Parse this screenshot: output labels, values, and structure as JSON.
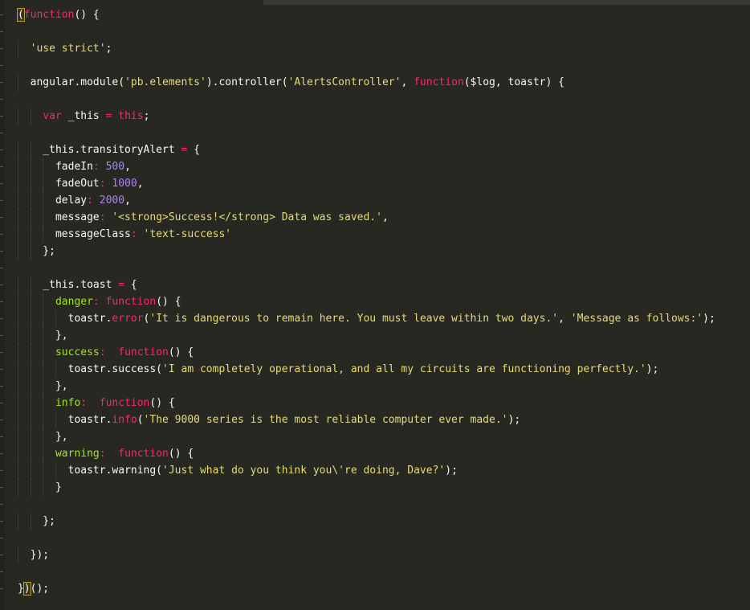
{
  "lines": [
    [
      {
        "t": "(",
        "c": "plain bracket-hl"
      },
      {
        "t": "function",
        "c": "kw"
      },
      {
        "t": "() {",
        "c": "plain"
      }
    ],
    [],
    [
      {
        "t": "  ",
        "c": "plain"
      },
      {
        "t": "'use strict'",
        "c": "str"
      },
      {
        "t": ";",
        "c": "plain"
      }
    ],
    [],
    [
      {
        "t": "  angular.module(",
        "c": "plain"
      },
      {
        "t": "'pb.elements'",
        "c": "str"
      },
      {
        "t": ").controller(",
        "c": "plain"
      },
      {
        "t": "'AlertsController'",
        "c": "str"
      },
      {
        "t": ", ",
        "c": "plain"
      },
      {
        "t": "function",
        "c": "kw"
      },
      {
        "t": "($log, toastr) {",
        "c": "plain"
      }
    ],
    [],
    [
      {
        "t": "    ",
        "c": "plain"
      },
      {
        "t": "var",
        "c": "kw"
      },
      {
        "t": " _this ",
        "c": "plain"
      },
      {
        "t": "=",
        "c": "kw"
      },
      {
        "t": " ",
        "c": "plain"
      },
      {
        "t": "this",
        "c": "kw"
      },
      {
        "t": ";",
        "c": "plain"
      }
    ],
    [],
    [
      {
        "t": "    _this.transitoryAlert ",
        "c": "plain"
      },
      {
        "t": "=",
        "c": "kw"
      },
      {
        "t": " {",
        "c": "plain"
      }
    ],
    [
      {
        "t": "      fadeIn",
        "c": "plain"
      },
      {
        "t": ":",
        "c": "kw"
      },
      {
        "t": " ",
        "c": "plain"
      },
      {
        "t": "500",
        "c": "num"
      },
      {
        "t": ",",
        "c": "plain"
      }
    ],
    [
      {
        "t": "      fadeOut",
        "c": "plain"
      },
      {
        "t": ":",
        "c": "kw"
      },
      {
        "t": " ",
        "c": "plain"
      },
      {
        "t": "1000",
        "c": "num"
      },
      {
        "t": ",",
        "c": "plain"
      }
    ],
    [
      {
        "t": "      delay",
        "c": "plain"
      },
      {
        "t": ":",
        "c": "kw"
      },
      {
        "t": " ",
        "c": "plain"
      },
      {
        "t": "2000",
        "c": "num"
      },
      {
        "t": ",",
        "c": "plain"
      }
    ],
    [
      {
        "t": "      message",
        "c": "plain"
      },
      {
        "t": ":",
        "c": "kw"
      },
      {
        "t": " ",
        "c": "plain"
      },
      {
        "t": "'<strong>Success!</strong> Data was saved.'",
        "c": "str"
      },
      {
        "t": ",",
        "c": "plain"
      }
    ],
    [
      {
        "t": "      messageClass",
        "c": "plain"
      },
      {
        "t": ":",
        "c": "kw"
      },
      {
        "t": " ",
        "c": "plain"
      },
      {
        "t": "'text-success'",
        "c": "str"
      }
    ],
    [
      {
        "t": "    };",
        "c": "plain"
      }
    ],
    [],
    [
      {
        "t": "    _this.toast ",
        "c": "plain"
      },
      {
        "t": "=",
        "c": "kw"
      },
      {
        "t": " {",
        "c": "plain"
      }
    ],
    [
      {
        "t": "      ",
        "c": "plain"
      },
      {
        "t": "danger",
        "c": "prop"
      },
      {
        "t": ":",
        "c": "kw"
      },
      {
        "t": " ",
        "c": "plain"
      },
      {
        "t": "function",
        "c": "kw"
      },
      {
        "t": "() {",
        "c": "plain"
      }
    ],
    [
      {
        "t": "        toastr.",
        "c": "plain"
      },
      {
        "t": "error",
        "c": "kw"
      },
      {
        "t": "(",
        "c": "plain"
      },
      {
        "t": "'It is dangerous to remain here. You must leave within two days.'",
        "c": "str"
      },
      {
        "t": ", ",
        "c": "plain"
      },
      {
        "t": "'Message as follows:'",
        "c": "str"
      },
      {
        "t": ");",
        "c": "plain"
      }
    ],
    [
      {
        "t": "      },",
        "c": "plain"
      }
    ],
    [
      {
        "t": "      ",
        "c": "plain"
      },
      {
        "t": "success",
        "c": "prop"
      },
      {
        "t": ":",
        "c": "kw"
      },
      {
        "t": "  ",
        "c": "plain"
      },
      {
        "t": "function",
        "c": "kw"
      },
      {
        "t": "() {",
        "c": "plain"
      }
    ],
    [
      {
        "t": "        toastr.success(",
        "c": "plain"
      },
      {
        "t": "'I am completely operational, and all my circuits are functioning perfectly.'",
        "c": "str"
      },
      {
        "t": ");",
        "c": "plain"
      }
    ],
    [
      {
        "t": "      },",
        "c": "plain"
      }
    ],
    [
      {
        "t": "      ",
        "c": "plain"
      },
      {
        "t": "info",
        "c": "prop"
      },
      {
        "t": ":",
        "c": "kw"
      },
      {
        "t": "  ",
        "c": "plain"
      },
      {
        "t": "function",
        "c": "kw"
      },
      {
        "t": "() {",
        "c": "plain"
      }
    ],
    [
      {
        "t": "        toastr.",
        "c": "plain"
      },
      {
        "t": "info",
        "c": "kw"
      },
      {
        "t": "(",
        "c": "plain"
      },
      {
        "t": "'The 9000 series is the most reliable computer ever made.'",
        "c": "str"
      },
      {
        "t": ");",
        "c": "plain"
      }
    ],
    [
      {
        "t": "      },",
        "c": "plain"
      }
    ],
    [
      {
        "t": "      ",
        "c": "plain"
      },
      {
        "t": "warning",
        "c": "prop"
      },
      {
        "t": ":",
        "c": "kw"
      },
      {
        "t": "  ",
        "c": "plain"
      },
      {
        "t": "function",
        "c": "kw"
      },
      {
        "t": "() {",
        "c": "plain"
      }
    ],
    [
      {
        "t": "        toastr.warning(",
        "c": "plain"
      },
      {
        "t": "'Just what do you think you\\'re doing, Dave?'",
        "c": "str"
      },
      {
        "t": ");",
        "c": "plain"
      }
    ],
    [
      {
        "t": "      }",
        "c": "plain"
      }
    ],
    [],
    [
      {
        "t": "    };",
        "c": "plain"
      }
    ],
    [],
    [
      {
        "t": "  });",
        "c": "plain"
      }
    ],
    [],
    [
      {
        "t": "}",
        "c": "plain"
      },
      {
        "t": ")",
        "c": "plain bracket-hl"
      },
      {
        "t": "();",
        "c": "plain"
      }
    ]
  ]
}
